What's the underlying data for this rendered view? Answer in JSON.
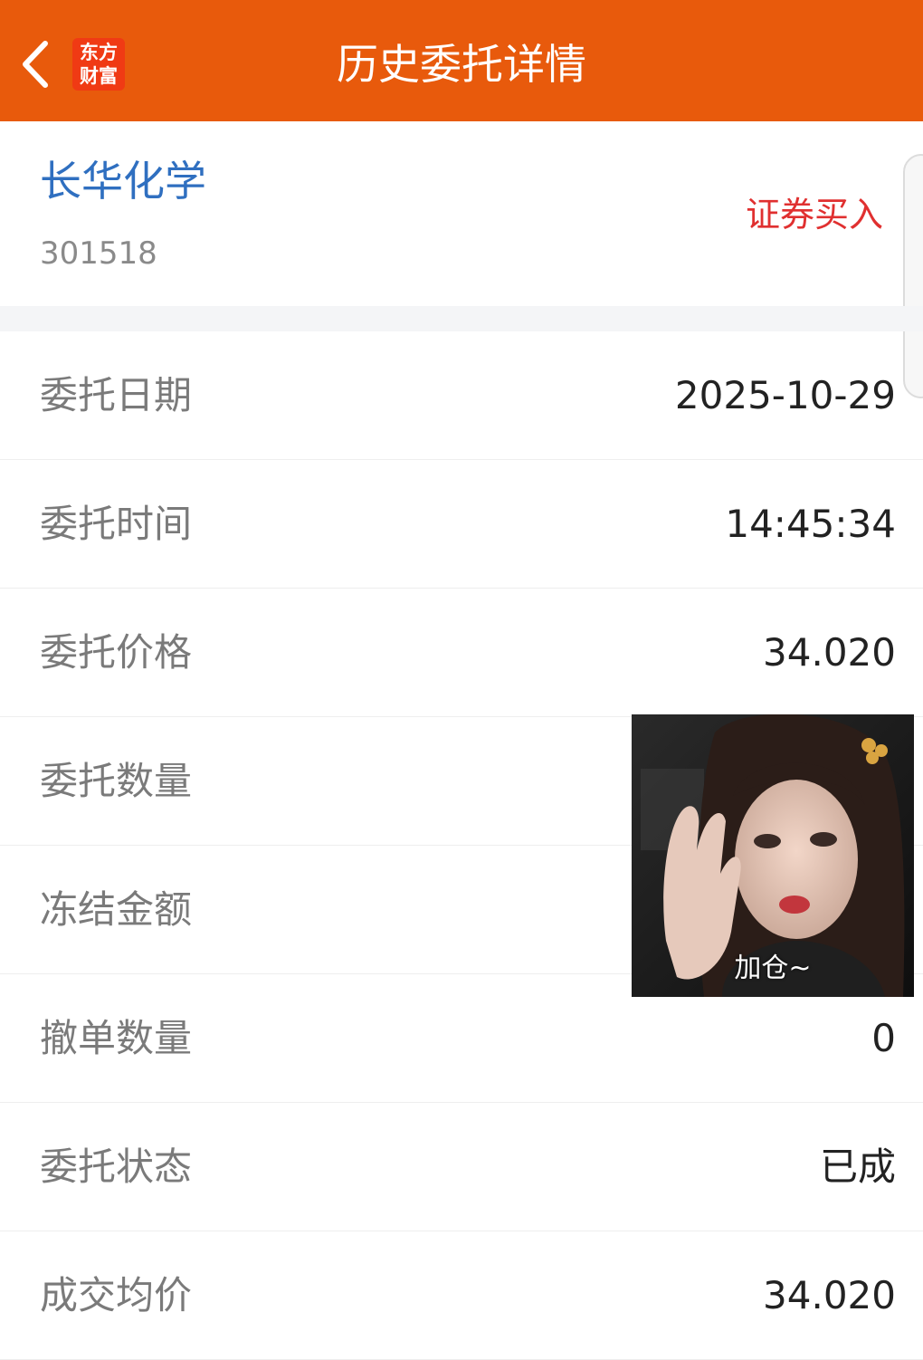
{
  "header": {
    "title": "历史委托详情",
    "logo_line1": "东方",
    "logo_line2": "财富",
    "color": "#e85a0c"
  },
  "stock": {
    "name": "长华化学",
    "code": "301518",
    "trade_type": "证券买入"
  },
  "rows": [
    {
      "label": "委托日期",
      "value": "2025-10-29"
    },
    {
      "label": "委托时间",
      "value": "14:45:34"
    },
    {
      "label": "委托价格",
      "value": "34.020"
    },
    {
      "label": "委托数量",
      "value": ""
    },
    {
      "label": "冻结金额",
      "value": ""
    },
    {
      "label": "撤单数量",
      "value": "0"
    },
    {
      "label": "委托状态",
      "value": "已成"
    },
    {
      "label": "成交均价",
      "value": "34.020"
    }
  ],
  "sticker": {
    "caption": "加仓~"
  }
}
